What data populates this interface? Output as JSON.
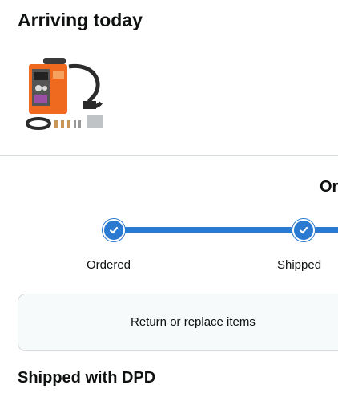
{
  "delivery": {
    "title": "Arriving today"
  },
  "product": {
    "image_icon": "welder-machine-image"
  },
  "order_status": {
    "heading_partial": "Or"
  },
  "progress": {
    "steps": [
      {
        "label": "Ordered",
        "done": true
      },
      {
        "label": "Shipped",
        "done": true
      }
    ],
    "accent_color": "#2a7ad1"
  },
  "actions": {
    "return_label": "Return or replace items"
  },
  "shipping": {
    "carrier_text": "Shipped with DPD"
  }
}
